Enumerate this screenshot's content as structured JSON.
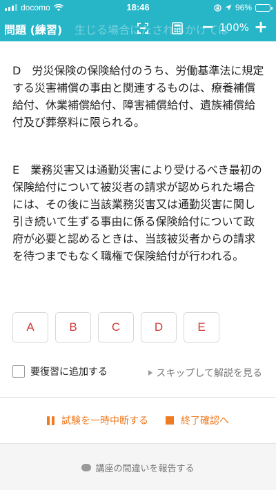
{
  "status_bar": {
    "carrier": "docomo",
    "time": "18:46",
    "battery_text": "96%",
    "battery_level": 0.96
  },
  "header": {
    "title": "問題 (練習)",
    "ghost_text": "生じる場合にたされるかけては",
    "zoom_minus": "−",
    "zoom_level": "100%",
    "zoom_plus": "+"
  },
  "question": {
    "option_d": "D　労災保険の保険給付のうち、労働基準法に規定する災害補償の事由と関連するものは、療養補償給付、休業補償給付、障害補償給付、遺族補償給付及び葬祭料に限られる。",
    "option_e": "E　業務災害又は通勤災害により受けるべき最初の保険給付について被災者の請求が認められた場合には、その後に当該業務災害又は通勤災害に関し引き続いて生ずる事由に係る保険給付について政府が必要と認めるときは、当該被災者からの請求を待つまでもなく職権で保険給付が行われる。"
  },
  "answers": [
    "A",
    "B",
    "C",
    "D",
    "E"
  ],
  "review": {
    "label": "要復習に追加する",
    "skip_label": "スキップして解説を見る"
  },
  "actions": {
    "pause_label": "試験を一時中断する",
    "end_label": "終了確認へ"
  },
  "footer": {
    "report_label": "講座の間違いを報告する"
  },
  "colors": {
    "header_bg": "#27b5c8",
    "answer_text": "#d23a3a",
    "action": "#ef7b22"
  }
}
